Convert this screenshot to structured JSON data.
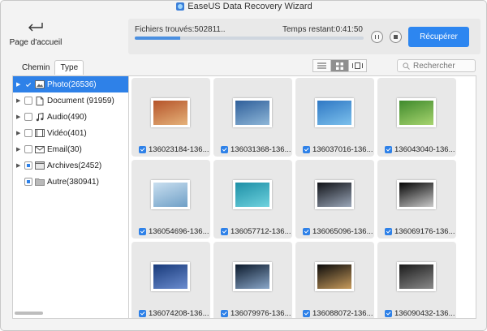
{
  "window": {
    "title": "EaseUS Data Recovery Wizard"
  },
  "home": {
    "label": "Page d'accueil"
  },
  "scan": {
    "found_text": "Fichiers trouvés:502811..",
    "remaining_text": "Temps restant:0:41:50",
    "progress": 0.2,
    "recover_label": "Récupérer"
  },
  "tabs": [
    {
      "label": "Chemin"
    },
    {
      "label": "Type"
    }
  ],
  "search": {
    "placeholder": "Rechercher"
  },
  "tree": [
    {
      "label": "Photo(26536)",
      "selected": true,
      "state": "checked",
      "icon": "photo-icon"
    },
    {
      "label": "Document (91959)",
      "state": "unchecked",
      "icon": "document-icon"
    },
    {
      "label": "Audio(490)",
      "state": "unchecked",
      "icon": "music-note-icon"
    },
    {
      "label": "Vidéo(401)",
      "state": "unchecked",
      "icon": "video-icon"
    },
    {
      "label": "Email(30)",
      "state": "unchecked",
      "icon": "envelope-icon"
    },
    {
      "label": "Archives(2452)",
      "state": "mixed",
      "icon": "archive-icon"
    },
    {
      "label": "Autre(380941)",
      "state": "mixed",
      "icon": "folder-icon"
    }
  ],
  "files": [
    {
      "name": "136023184-136...",
      "colors": [
        "#b5542a",
        "#e5b27a"
      ]
    },
    {
      "name": "136031368-136...",
      "colors": [
        "#2f5f9a",
        "#8fb7d8"
      ]
    },
    {
      "name": "136037016-136...",
      "colors": [
        "#2f78c4",
        "#7cc0ec"
      ]
    },
    {
      "name": "136043040-136...",
      "colors": [
        "#3f8a2c",
        "#a7d46f"
      ]
    },
    {
      "name": "136054696-136...",
      "colors": [
        "#c9dff0",
        "#6f9fc6"
      ]
    },
    {
      "name": "136057712-136...",
      "colors": [
        "#1d8fa6",
        "#6fd2de"
      ]
    },
    {
      "name": "136065096-136...",
      "colors": [
        "#111318",
        "#9aa6b8"
      ]
    },
    {
      "name": "136069176-136...",
      "colors": [
        "#050505",
        "#c9c9c9"
      ]
    },
    {
      "name": "136074208-136...",
      "colors": [
        "#183a7a",
        "#6b8ccf"
      ]
    },
    {
      "name": "136079976-136...",
      "colors": [
        "#0c1a2c",
        "#8aa7c9"
      ]
    },
    {
      "name": "136088072-136...",
      "colors": [
        "#0b0b0b",
        "#c79b5c"
      ]
    },
    {
      "name": "136090432-136...",
      "colors": [
        "#1b1b1b",
        "#8a8a8a"
      ]
    }
  ]
}
